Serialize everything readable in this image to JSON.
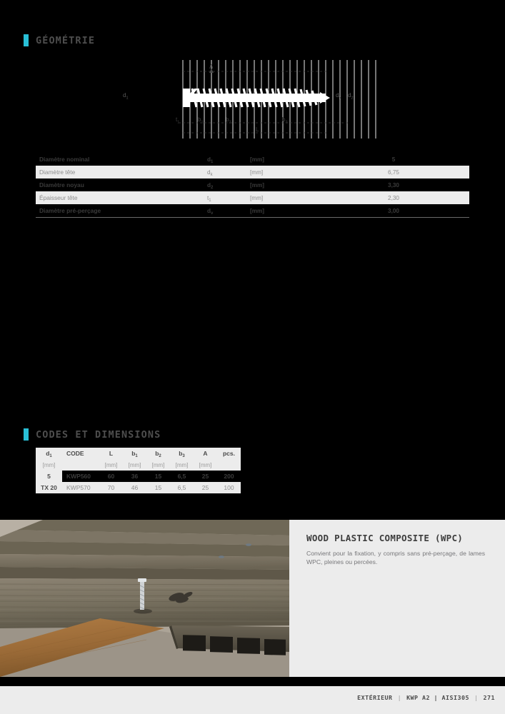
{
  "sections": {
    "geometry_heading": "GÉOMÉTRIE",
    "codes_heading": "CODES ET DIMENSIONS"
  },
  "diagram": {
    "labels": {
      "d1": "d",
      "d1_sub": "1",
      "dk": "d",
      "dk_sub": "k",
      "d2": "d",
      "d2_sub": "2",
      "t1": "t",
      "t1_sub": "1",
      "b1": "b",
      "b1_sub": "1",
      "b2": "b",
      "b2_sub": "2",
      "b3": "b",
      "b3_sub": "3",
      "A": "A",
      "L": "L"
    }
  },
  "geometry_table": {
    "rows": [
      {
        "label": "Diamètre nominal",
        "symbol": "d",
        "sub": "1",
        "unit": "[mm]",
        "value": "5"
      },
      {
        "label": "Diamètre tête",
        "symbol": "d",
        "sub": "k",
        "unit": "[mm]",
        "value": "6,75"
      },
      {
        "label": "Diamètre noyau",
        "symbol": "d",
        "sub": "2",
        "unit": "[mm]",
        "value": "3,30"
      },
      {
        "label": "Épaisseur tête",
        "symbol": "t",
        "sub": "1",
        "unit": "[mm]",
        "value": "2,30"
      },
      {
        "label": "Diamètre pré-perçage",
        "symbol": "d",
        "sub": "v",
        "unit": "[mm]",
        "value": "3,00"
      }
    ]
  },
  "codes_table": {
    "headers": [
      {
        "text": "d",
        "sub": "1"
      },
      {
        "text": "CODE",
        "sub": ""
      },
      {
        "text": "L",
        "sub": ""
      },
      {
        "text": "b",
        "sub": "1"
      },
      {
        "text": "b",
        "sub": "2"
      },
      {
        "text": "b",
        "sub": "3"
      },
      {
        "text": "A",
        "sub": ""
      },
      {
        "text": "pcs.",
        "sub": ""
      }
    ],
    "units": [
      "[mm]",
      "",
      "[mm]",
      "[mm]",
      "[mm]",
      "[mm]",
      "[mm]",
      ""
    ],
    "d1_value": "5",
    "drive": "TX 20",
    "rows": [
      {
        "code": "KWP560",
        "L": "60",
        "b1": "36",
        "b2": "15",
        "b3": "6,5",
        "A": "25",
        "pcs": "200"
      },
      {
        "code": "KWP570",
        "L": "70",
        "b1": "46",
        "b2": "15",
        "b3": "6,5",
        "A": "25",
        "pcs": "100"
      }
    ]
  },
  "info": {
    "title": "WOOD PLASTIC COMPOSITE (WPC)",
    "text": "Convient pour la fixation, y compris sans pré-perçage, de lames WPC, pleines ou percées."
  },
  "footer": {
    "category": "EXTÉRIEUR",
    "product": "KWP A2 | AISI305",
    "page": "271",
    "separator": "|"
  },
  "colors": {
    "accent": "#29bfd6",
    "panel": "#ececec",
    "background": "#000000"
  }
}
